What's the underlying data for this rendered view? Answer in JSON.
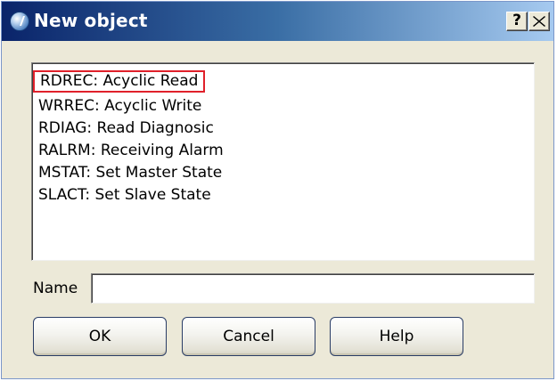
{
  "window": {
    "title": "New object",
    "help_caption": "?"
  },
  "list": {
    "items": [
      "RDREC: Acyclic Read",
      "WRREC: Acyclic Write",
      "RDIAG: Read Diagnosic",
      "RALRM: Receiving Alarm",
      "MSTAT: Set Master State",
      "SLACT: Set Slave State"
    ],
    "selected_index": 0
  },
  "name_field": {
    "label": "Name",
    "value": ""
  },
  "buttons": {
    "ok": "OK",
    "cancel": "Cancel",
    "help": "Help"
  },
  "colors": {
    "title_bar_start": "#0a246a",
    "title_bar_end": "#a6caf0",
    "dialog_background": "#ece9d8",
    "selection_outline": "#e0202a"
  }
}
